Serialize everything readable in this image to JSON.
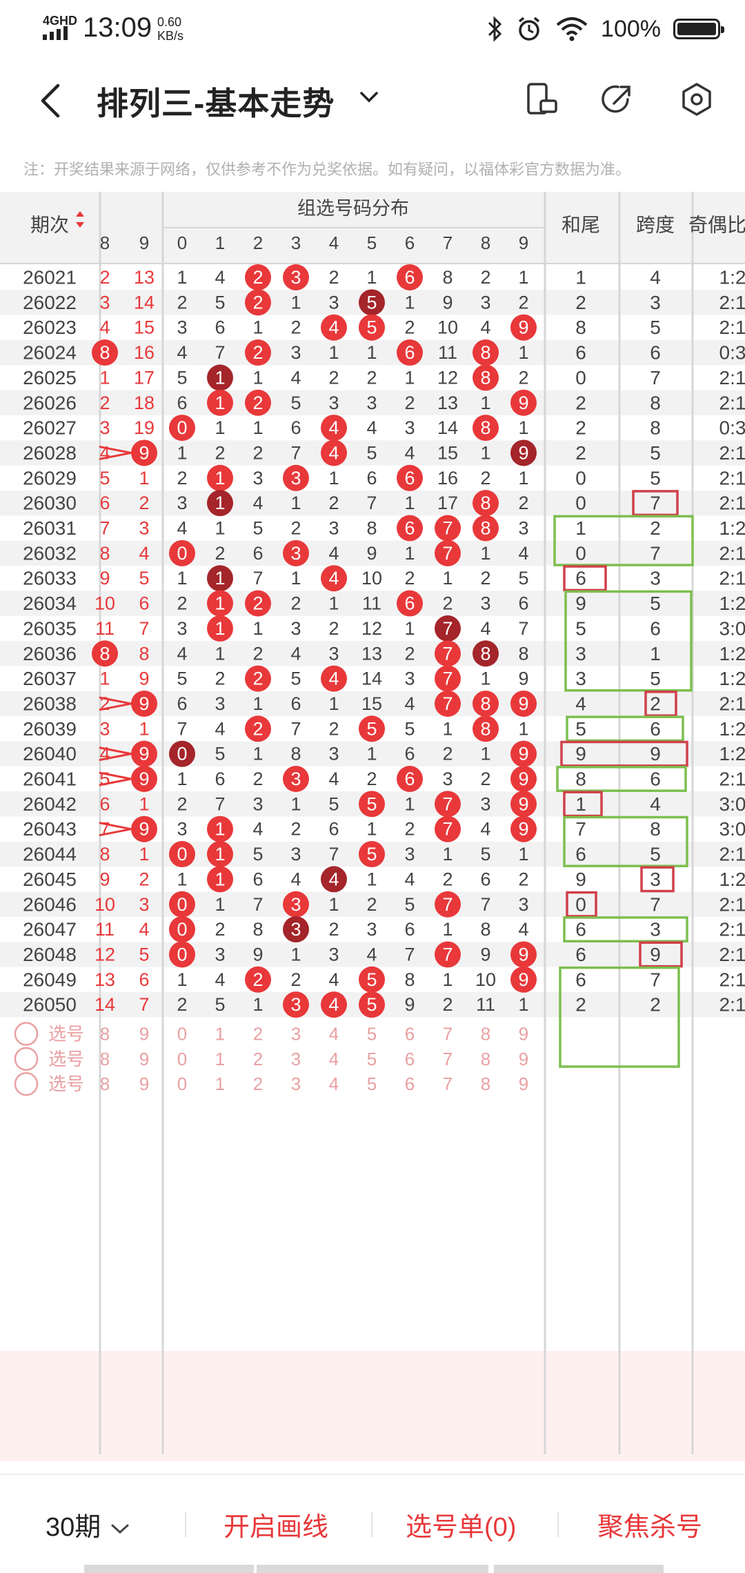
{
  "status_bar": {
    "network": "4GHD",
    "time": "13:09",
    "speed_value": "0.60",
    "speed_unit": "KB/s",
    "battery": "100%"
  },
  "header": {
    "title": "排列三-基本走势"
  },
  "notice": "注：开奖结果来源于网络，仅供参考不作为兑奖依据。如有疑问，以福体彩官方数据为准。",
  "table": {
    "col_issue": "期次",
    "col_group": "组选号码分布",
    "col_hewei": "和尾",
    "col_kuadu": "跨度",
    "col_jiou": "奇偶比",
    "prev_digits": [
      "8",
      "9"
    ],
    "digits": [
      "0",
      "1",
      "2",
      "3",
      "4",
      "5",
      "6",
      "7",
      "8",
      "9"
    ],
    "rows": [
      {
        "issue": "26021",
        "p8": "2",
        "p9": "13",
        "g": [
          "1",
          "4",
          "2",
          "3",
          "2",
          "1",
          "6",
          "8",
          "2",
          "1"
        ],
        "hw": "1",
        "kd": "4",
        "jo": "1:2"
      },
      {
        "issue": "26022",
        "p8": "3",
        "p9": "14",
        "g": [
          "2",
          "5",
          "2",
          "1",
          "3",
          "5",
          "1",
          "9",
          "3",
          "2"
        ],
        "hw": "2",
        "kd": "3",
        "jo": "2:1"
      },
      {
        "issue": "26023",
        "p8": "4",
        "p9": "15",
        "g": [
          "3",
          "6",
          "1",
          "2",
          "4",
          "5",
          "2",
          "10",
          "4",
          "9"
        ],
        "hw": "8",
        "kd": "5",
        "jo": "2:1"
      },
      {
        "issue": "26024",
        "p8": "8",
        "p9": "16",
        "g": [
          "4",
          "7",
          "2",
          "3",
          "1",
          "1",
          "6",
          "11",
          "8",
          "1"
        ],
        "hw": "6",
        "kd": "6",
        "jo": "0:3"
      },
      {
        "issue": "26025",
        "p8": "1",
        "p9": "17",
        "g": [
          "5",
          "1",
          "1",
          "4",
          "2",
          "2",
          "1",
          "12",
          "8",
          "2"
        ],
        "hw": "0",
        "kd": "7",
        "jo": "2:1"
      },
      {
        "issue": "26026",
        "p8": "2",
        "p9": "18",
        "g": [
          "6",
          "1",
          "2",
          "5",
          "3",
          "3",
          "2",
          "13",
          "1",
          "9"
        ],
        "hw": "2",
        "kd": "8",
        "jo": "2:1"
      },
      {
        "issue": "26027",
        "p8": "3",
        "p9": "19",
        "g": [
          "0",
          "1",
          "1",
          "6",
          "4",
          "4",
          "3",
          "14",
          "8",
          "1"
        ],
        "hw": "2",
        "kd": "8",
        "jo": "0:3"
      },
      {
        "issue": "26028",
        "p8": "4",
        "p9": "9",
        "g": [
          "1",
          "2",
          "2",
          "7",
          "4",
          "5",
          "4",
          "15",
          "1",
          "9"
        ],
        "hw": "2",
        "kd": "5",
        "jo": "2:1"
      },
      {
        "issue": "26029",
        "p8": "5",
        "p9": "1",
        "g": [
          "2",
          "1",
          "3",
          "3",
          "1",
          "6",
          "6",
          "16",
          "2",
          "1"
        ],
        "hw": "0",
        "kd": "5",
        "jo": "2:1"
      },
      {
        "issue": "26030",
        "p8": "6",
        "p9": "2",
        "g": [
          "3",
          "1",
          "4",
          "1",
          "2",
          "7",
          "1",
          "17",
          "8",
          "2"
        ],
        "hw": "0",
        "kd": "7",
        "jo": "2:1"
      },
      {
        "issue": "26031",
        "p8": "7",
        "p9": "3",
        "g": [
          "4",
          "1",
          "5",
          "2",
          "3",
          "8",
          "6",
          "7",
          "8",
          "3"
        ],
        "hw": "1",
        "kd": "2",
        "jo": "1:2"
      },
      {
        "issue": "26032",
        "p8": "8",
        "p9": "4",
        "g": [
          "0",
          "2",
          "6",
          "3",
          "4",
          "9",
          "1",
          "7",
          "1",
          "4"
        ],
        "hw": "0",
        "kd": "7",
        "jo": "2:1"
      },
      {
        "issue": "26033",
        "p8": "9",
        "p9": "5",
        "g": [
          "1",
          "1",
          "7",
          "1",
          "4",
          "10",
          "2",
          "1",
          "2",
          "5"
        ],
        "hw": "6",
        "kd": "3",
        "jo": "2:1"
      },
      {
        "issue": "26034",
        "p8": "10",
        "p9": "6",
        "g": [
          "2",
          "1",
          "2",
          "2",
          "1",
          "11",
          "6",
          "2",
          "3",
          "6"
        ],
        "hw": "9",
        "kd": "5",
        "jo": "1:2"
      },
      {
        "issue": "26035",
        "p8": "11",
        "p9": "7",
        "g": [
          "3",
          "1",
          "1",
          "3",
          "2",
          "12",
          "1",
          "7",
          "4",
          "7"
        ],
        "hw": "5",
        "kd": "6",
        "jo": "3:0"
      },
      {
        "issue": "26036",
        "p8": "8",
        "p9": "8",
        "g": [
          "4",
          "1",
          "2",
          "4",
          "3",
          "13",
          "2",
          "7",
          "8",
          "8"
        ],
        "hw": "3",
        "kd": "1",
        "jo": "1:2"
      },
      {
        "issue": "26037",
        "p8": "1",
        "p9": "9",
        "g": [
          "5",
          "2",
          "2",
          "5",
          "4",
          "14",
          "3",
          "7",
          "1",
          "9"
        ],
        "hw": "3",
        "kd": "5",
        "jo": "1:2"
      },
      {
        "issue": "26038",
        "p8": "2",
        "p9": "9",
        "g": [
          "6",
          "3",
          "1",
          "6",
          "1",
          "15",
          "4",
          "7",
          "8",
          "9"
        ],
        "hw": "4",
        "kd": "2",
        "jo": "2:1"
      },
      {
        "issue": "26039",
        "p8": "3",
        "p9": "1",
        "g": [
          "7",
          "4",
          "2",
          "7",
          "2",
          "5",
          "5",
          "1",
          "8",
          "1"
        ],
        "hw": "5",
        "kd": "6",
        "jo": "1:2"
      },
      {
        "issue": "26040",
        "p8": "4",
        "p9": "9",
        "g": [
          "0",
          "5",
          "1",
          "8",
          "3",
          "1",
          "6",
          "2",
          "1",
          "9"
        ],
        "hw": "9",
        "kd": "9",
        "jo": "1:2"
      },
      {
        "issue": "26041",
        "p8": "5",
        "p9": "9",
        "g": [
          "1",
          "6",
          "2",
          "3",
          "4",
          "2",
          "6",
          "3",
          "2",
          "9"
        ],
        "hw": "8",
        "kd": "6",
        "jo": "2:1"
      },
      {
        "issue": "26042",
        "p8": "6",
        "p9": "1",
        "g": [
          "2",
          "7",
          "3",
          "1",
          "5",
          "5",
          "1",
          "7",
          "3",
          "9"
        ],
        "hw": "1",
        "kd": "4",
        "jo": "3:0"
      },
      {
        "issue": "26043",
        "p8": "7",
        "p9": "9",
        "g": [
          "3",
          "1",
          "4",
          "2",
          "6",
          "1",
          "2",
          "7",
          "4",
          "9"
        ],
        "hw": "7",
        "kd": "8",
        "jo": "3:0"
      },
      {
        "issue": "26044",
        "p8": "8",
        "p9": "1",
        "g": [
          "0",
          "1",
          "5",
          "3",
          "7",
          "5",
          "3",
          "1",
          "5",
          "1"
        ],
        "hw": "6",
        "kd": "5",
        "jo": "2:1"
      },
      {
        "issue": "26045",
        "p8": "9",
        "p9": "2",
        "g": [
          "1",
          "1",
          "6",
          "4",
          "4",
          "1",
          "4",
          "2",
          "6",
          "2"
        ],
        "hw": "9",
        "kd": "3",
        "jo": "1:2"
      },
      {
        "issue": "26046",
        "p8": "10",
        "p9": "3",
        "g": [
          "0",
          "1",
          "7",
          "3",
          "1",
          "2",
          "5",
          "7",
          "7",
          "3"
        ],
        "hw": "0",
        "kd": "7",
        "jo": "2:1"
      },
      {
        "issue": "26047",
        "p8": "11",
        "p9": "4",
        "g": [
          "0",
          "2",
          "8",
          "3",
          "2",
          "3",
          "6",
          "1",
          "8",
          "4"
        ],
        "hw": "6",
        "kd": "3",
        "jo": "2:1"
      },
      {
        "issue": "26048",
        "p8": "12",
        "p9": "5",
        "g": [
          "0",
          "3",
          "9",
          "1",
          "3",
          "4",
          "7",
          "7",
          "9",
          "9"
        ],
        "hw": "6",
        "kd": "9",
        "jo": "2:1"
      },
      {
        "issue": "26049",
        "p8": "13",
        "p9": "6",
        "g": [
          "1",
          "4",
          "2",
          "2",
          "4",
          "5",
          "8",
          "1",
          "10",
          "9"
        ],
        "hw": "6",
        "kd": "7",
        "jo": "2:1"
      },
      {
        "issue": "26050",
        "p8": "14",
        "p9": "7",
        "g": [
          "2",
          "5",
          "1",
          "3",
          "4",
          "5",
          "9",
          "2",
          "11",
          "1"
        ],
        "hw": "2",
        "kd": "2",
        "jo": "2:1"
      }
    ],
    "select_label": "选号"
  },
  "bottom_bar": {
    "periods": "30期",
    "draw_lines": "开启画线",
    "selection": "选号单(0)",
    "focus": "聚焦杀号"
  },
  "colors": {
    "accent_red": "#e8383a",
    "dark_red": "#a4252a",
    "green_box": "#7cbf4e",
    "red_box": "#d0404a",
    "zebra": "#f2f2f2"
  }
}
